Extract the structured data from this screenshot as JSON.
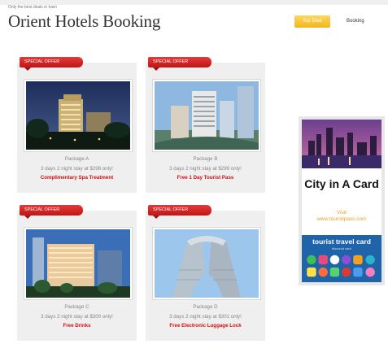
{
  "header": {
    "tagline": "Only the best deals in town",
    "title": "Orient Hotels Booking"
  },
  "nav": {
    "top_deal": "Top Deal",
    "booking": "Booking"
  },
  "ribbon_label": "SPECIAL OFFER",
  "packages": [
    {
      "name": "Package A",
      "desc": "3 days 2 night stay at $298 only!",
      "perk": "Complimentary Spa Treatment"
    },
    {
      "name": "Package B",
      "desc": "3 days 2 night stay at $299 only!",
      "perk": "Free 1 Day Tourist Pass"
    },
    {
      "name": "Package C",
      "desc": "3 days 2 night stay at $300 only!",
      "perk": "Free Drinks"
    },
    {
      "name": "Package D",
      "desc": "3 days 2 night stay at $301 only!",
      "perk": "Free Electronic Luggage Lock"
    }
  ],
  "ad": {
    "headline": "City in A Card",
    "visit": "Visit",
    "url": "www.touristpass.com",
    "brand": "tourist travel card",
    "sub": "discount card"
  },
  "colors": {
    "ribbon": "#d42323",
    "perk": "#d01010",
    "nav_button": "#f5c33a",
    "ad_blue": "#1f63a8",
    "ad_url": "#e8a020"
  }
}
